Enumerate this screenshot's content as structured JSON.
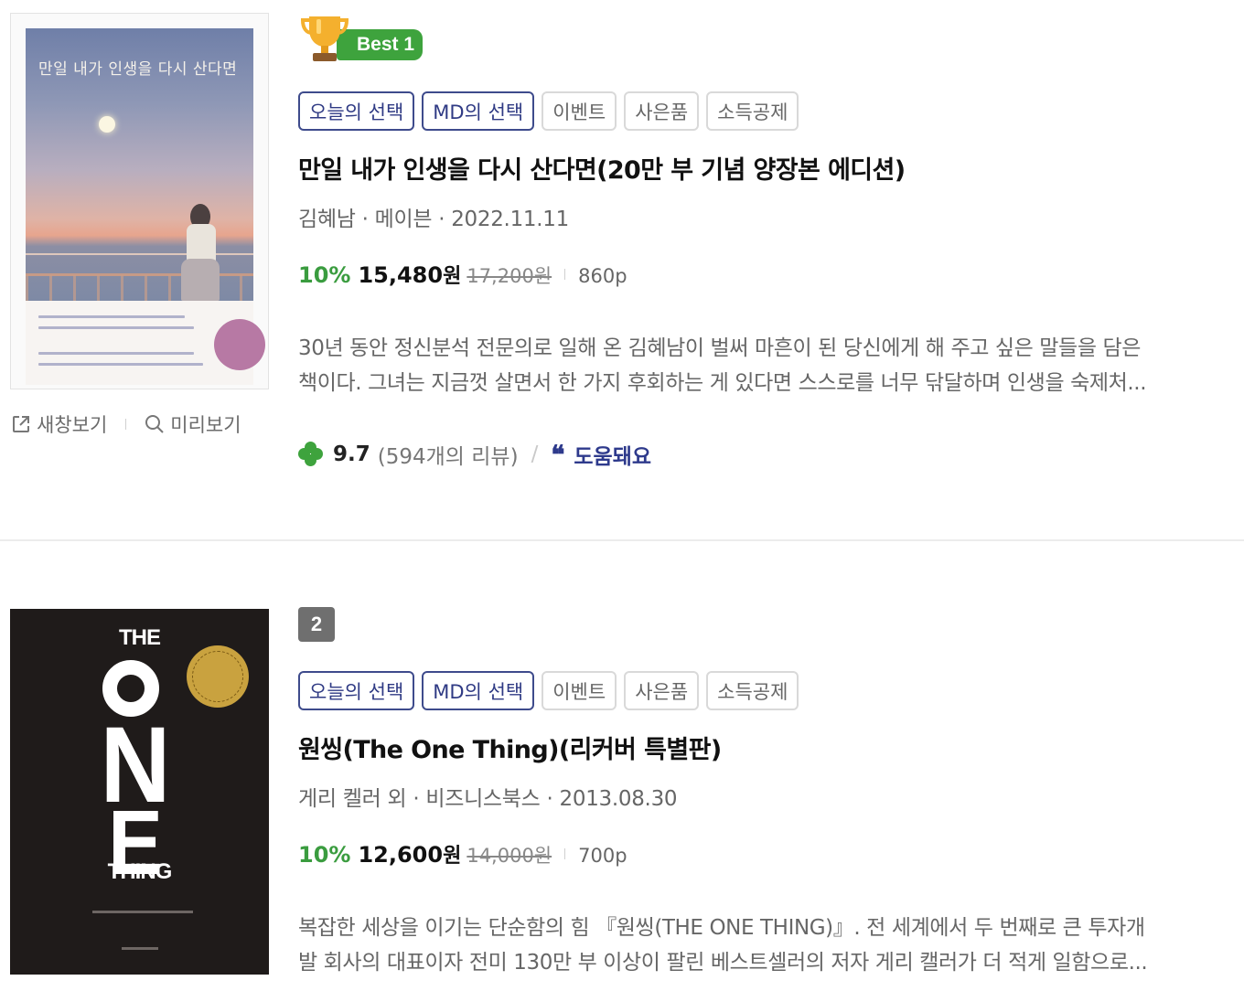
{
  "items": [
    {
      "rank_label": "Best 1",
      "tags": [
        "오늘의 선택",
        "MD의 선택",
        "이벤트",
        "사은품",
        "소득공제"
      ],
      "title": "만일 내가 인생을 다시 산다면(20만 부 기념 양장본 에디션)",
      "meta": "김혜남 · 메이븐 · 2022.11.11",
      "discount": "10%",
      "sale_price": "15,480",
      "won": "원",
      "original_price": "17,200원",
      "pages": "860p",
      "description": [
        "30년 동안 정신분석 전문의로 일해 온 김혜남이 벌써 마흔이 된 당신에게 해 주고 싶은 말들을 담은",
        "책이다. 그녀는 지금껏 살면서 한 가지 후회하는 게 있다면 스스로를 너무 닦달하며 인생을 숙제처..."
      ],
      "cover_title": "만일 내가 인생을 다시 산다면",
      "rating": "9.7",
      "review_count": "(594개의 리뷰)",
      "review_separator": "/",
      "helpful_label": "도움돼요"
    },
    {
      "rank_label": "2",
      "tags": [
        "오늘의 선택",
        "MD의 선택",
        "이벤트",
        "사은품",
        "소득공제"
      ],
      "title": "원씽(The One Thing)(리커버 특별판)",
      "meta": "게리 켈러 외 · 비즈니스북스 · 2013.08.30",
      "discount": "10%",
      "sale_price": "12,600",
      "won": "원",
      "original_price": "14,000원",
      "pages": "700p",
      "description": [
        "복잡한 세상을 이기는 단순함의 힘 『원씽(THE ONE THING)』. 전 세계에서 두 번째로 큰 투자개",
        "발 회사의 대표이자 전미 130만 부 이상이 팔린 베스트셀러의 저자 게리 캘러가 더 적게 일함으로..."
      ],
      "cover_words": [
        "THE",
        "N",
        "E",
        "THING"
      ]
    }
  ],
  "actions": {
    "new_window": "새창보기",
    "preview": "미리보기"
  },
  "colors": {
    "green": "#3ea33d",
    "navy": "#2e3a8c",
    "rank_gray": "#6f6f6f"
  }
}
